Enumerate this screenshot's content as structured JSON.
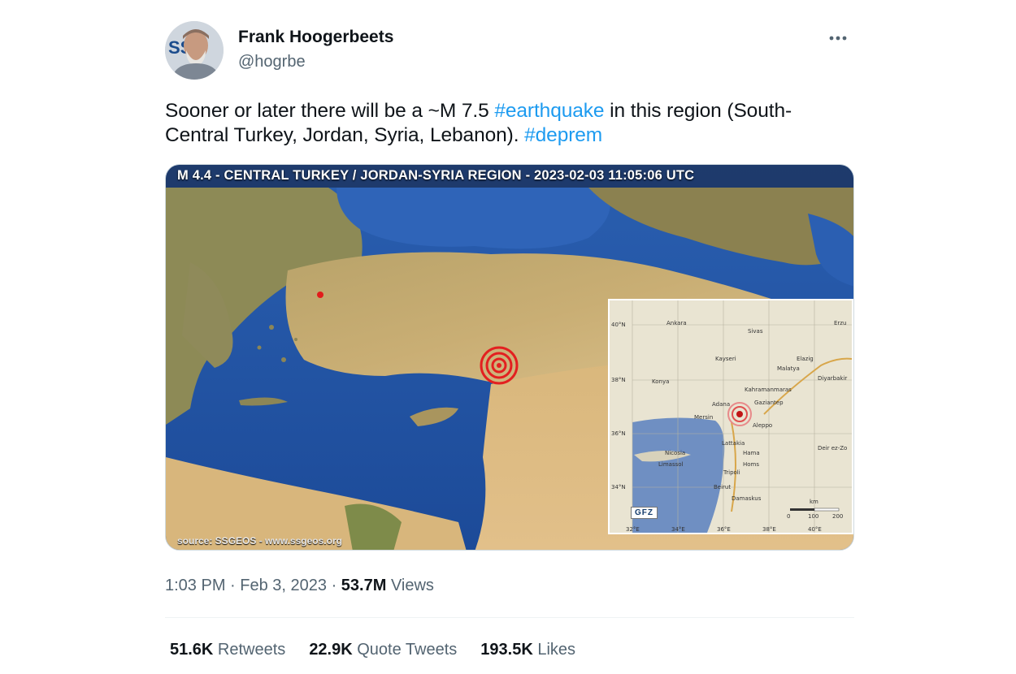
{
  "author": {
    "display_name": "Frank Hoogerbeets",
    "handle": "@hogrbe",
    "avatar_badge": "SSG"
  },
  "tweet": {
    "text_parts": [
      {
        "text": "Sooner or later there will be a ~M 7.5 ",
        "type": "text"
      },
      {
        "text": "#earthquake",
        "type": "hashtag"
      },
      {
        "text": " in this region (South-Central Turkey, Jordan, Syria, Lebanon). ",
        "type": "text"
      },
      {
        "text": "#deprem",
        "type": "hashtag"
      }
    ]
  },
  "media": {
    "title": "M 4.4 - CENTRAL TURKEY / JORDAN-SYRIA REGION - 2023-02-03 11:05:06 UTC",
    "source": "source: SSGEOS - www.ssgeos.org",
    "inset": {
      "lat_labels": [
        "40°N",
        "38°N",
        "36°N",
        "34°N"
      ],
      "lon_labels": [
        "32°E",
        "34°E",
        "36°E",
        "38°E",
        "40°E"
      ],
      "cities": [
        "Ankara",
        "Sivas",
        "Erzu",
        "Kayseri",
        "Elazig",
        "Malatya",
        "Konya",
        "Kahramanmaras",
        "Diyarbakir",
        "Adana",
        "Gaziantep",
        "Mersin",
        "Aleppo",
        "Lattakia",
        "Nicosia",
        "Limassol",
        "Hama",
        "Homs",
        "Deir ez-Zo",
        "Tripoli",
        "Beirut",
        "Damaskus"
      ],
      "logo": "GFZ",
      "scale_unit": "km",
      "scale_ticks": [
        "0",
        "100",
        "200"
      ]
    }
  },
  "meta": {
    "time": "1:03 PM",
    "separator": " · ",
    "date": "Feb 3, 2023",
    "views_count": "53.7M",
    "views_label": " Views"
  },
  "stats": {
    "retweets_count": "51.6K",
    "retweets_label": " Retweets",
    "quotes_count": "22.9K",
    "quotes_label": " Quote Tweets",
    "likes_count": "193.5K",
    "likes_label": " Likes"
  },
  "colors": {
    "link": "#1d9bf0",
    "secondary_text": "#536471",
    "primary_text": "#0f1419"
  },
  "icons": {
    "more": "more-horizontal-icon"
  }
}
